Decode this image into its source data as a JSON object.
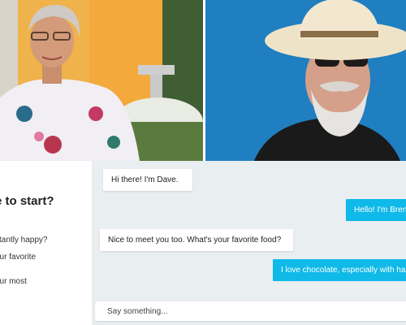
{
  "sidebar": {
    "title": "e to start?",
    "prompts": [
      "stantly happy?",
      "our favorite",
      "our most"
    ]
  },
  "chat": {
    "messages": [
      {
        "from": "Dave",
        "text": "Hi there! I'm Dave."
      },
      {
        "from": "me",
        "text": "Hello! I'm Brend"
      },
      {
        "from": "Dave",
        "text": "Nice to meet you too. What's your favorite food?"
      },
      {
        "from": "me",
        "text": "I love chocolate, especially with haze"
      }
    ],
    "composer_placeholder": "Say something..."
  },
  "colors": {
    "accent": "#0fb9e8",
    "background": "#e9eef0"
  }
}
